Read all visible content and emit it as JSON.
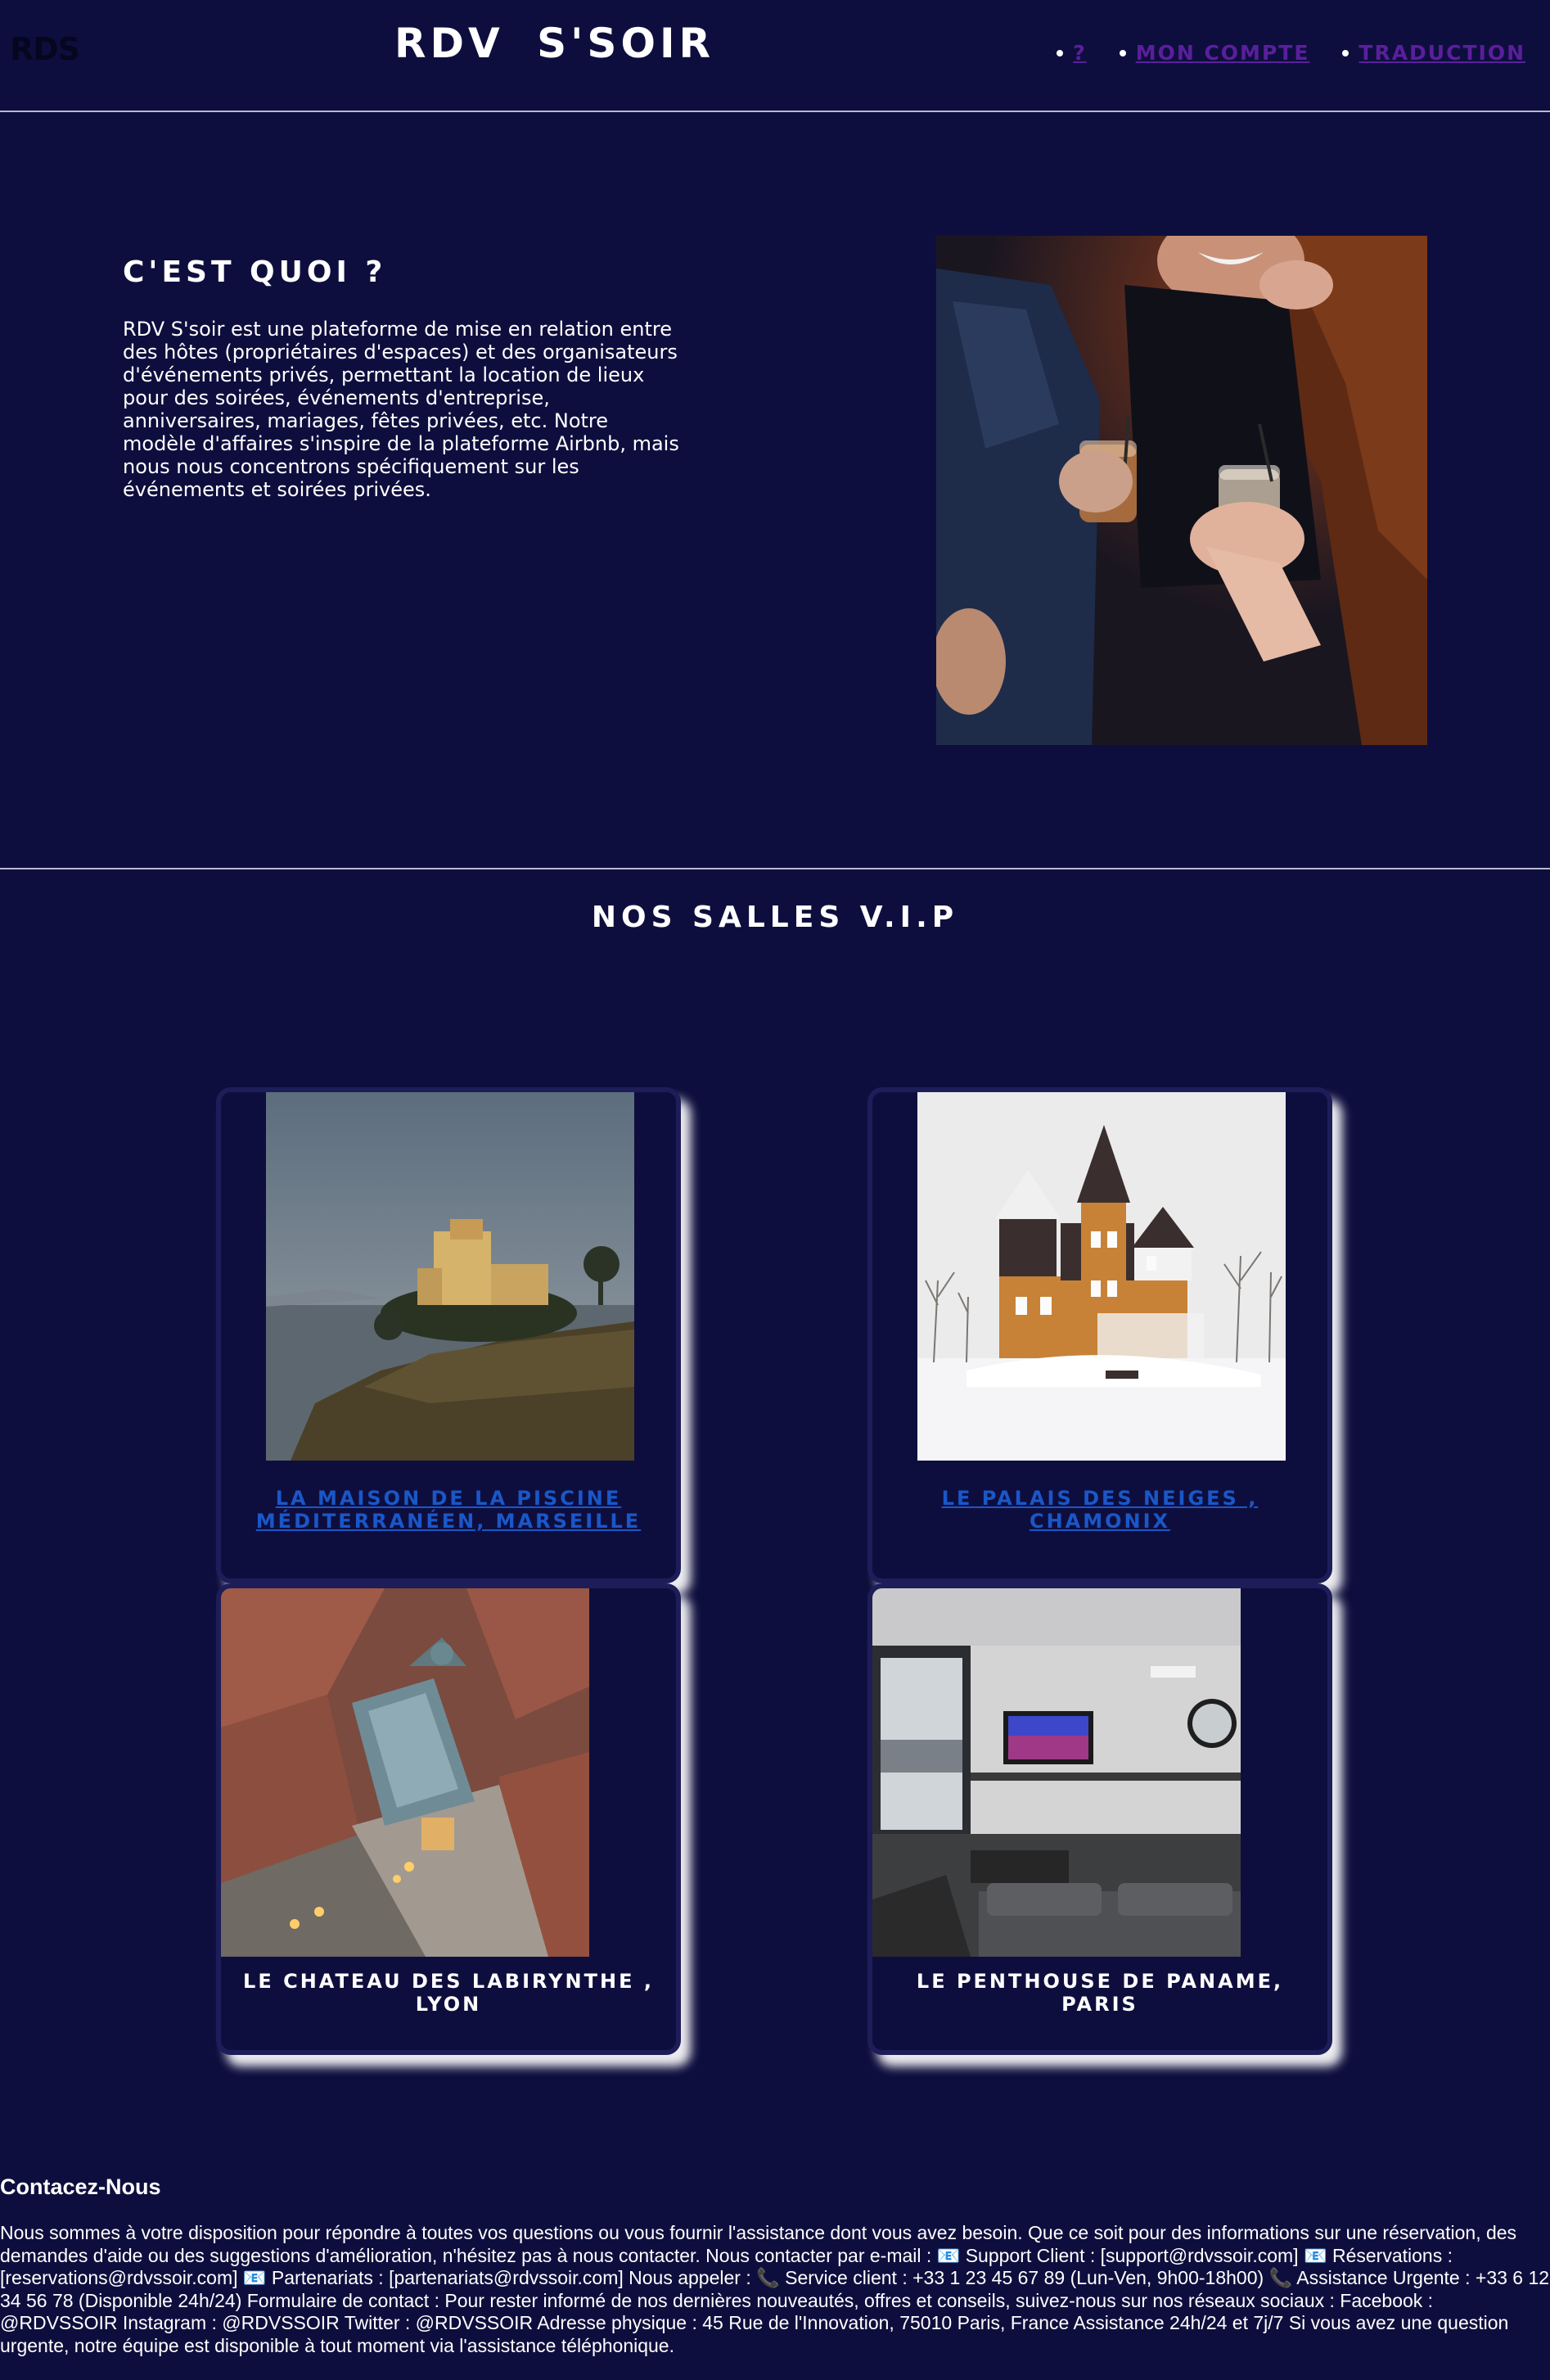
{
  "header": {
    "logo": "RDS",
    "title": "RDV S'SOIR",
    "nav": [
      {
        "label": "?"
      },
      {
        "label": "MON COMPTE"
      },
      {
        "label": "TRADUCTION"
      }
    ]
  },
  "about": {
    "heading": "C'EST QUOI ?",
    "text": "RDV S'soir est une plateforme de mise en relation entre des hôtes (propriétaires d'espaces) et des organisateurs d'événements privés, permettant la location de lieux pour des soirées, événements d'entreprise, anniversaires, mariages, fêtes privées, etc. Notre modèle d'affaires s'inspire de la plateforme Airbnb, mais nous nous concentrons spécifiquement sur les événements et soirées privées."
  },
  "vip": {
    "heading": "NOS SALLES V.I.P",
    "venues": [
      {
        "name": "LA MAISON DE LA PISCINE MÉDITERRANÉEN, MARSEILLE"
      },
      {
        "name": "LE PALAIS DES NEIGES , CHAMONIX"
      },
      {
        "name": "LE CHATEAU DES LABIRYNTHE , LYON"
      },
      {
        "name": "LE PENTHOUSE DE PANAME, PARIS"
      }
    ]
  },
  "contact": {
    "heading": "Contacez-Nous",
    "text": "Nous sommes à votre disposition pour répondre à toutes vos questions ou vous fournir l'assistance dont vous avez besoin. Que ce soit pour des informations sur une réservation, des demandes d'aide ou des suggestions d'amélioration, n'hésitez pas à nous contacter. Nous contacter par e-mail : 📧 Support Client : [support@rdvssoir.com] 📧 Réservations : [reservations@rdvssoir.com] 📧 Partenariats : [partenariats@rdvssoir.com] Nous appeler : 📞 Service client : +33 1 23 45 67 89 (Lun-Ven, 9h00-18h00) 📞 Assistance Urgente : +33 6 12 34 56 78 (Disponible 24h/24) Formulaire de contact : Pour rester informé de nos dernières nouveautés, offres et conseils, suivez-nous sur nos réseaux sociaux : Facebook : @RDVSSOIR Instagram : @RDVSSOIR Twitter : @RDVSSOIR Adresse physique : 45 Rue de l'Innovation, 75010 Paris, France Assistance 24h/24 et 7j/7 Si vous avez une question urgente, notre équipe est disponible à tout moment via l'assistance téléphonique."
  }
}
